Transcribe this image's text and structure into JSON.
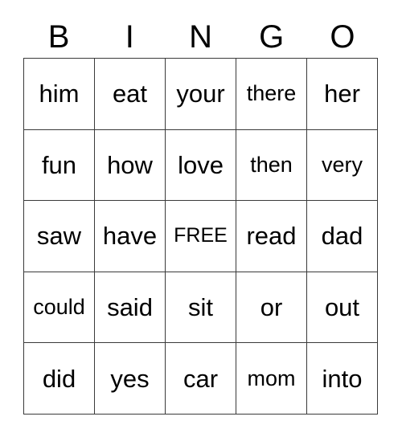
{
  "card": {
    "title_letters": [
      "B",
      "I",
      "N",
      "G",
      "O"
    ],
    "grid": [
      [
        "him",
        "eat",
        "your",
        "there",
        "her"
      ],
      [
        "fun",
        "how",
        "love",
        "then",
        "very"
      ],
      [
        "saw",
        "have",
        "FREE",
        "read",
        "dad"
      ],
      [
        "could",
        "said",
        "sit",
        "or",
        "out"
      ],
      [
        "did",
        "yes",
        "car",
        "mom",
        "into"
      ]
    ],
    "free_space": {
      "row": 2,
      "col": 2,
      "label": "FREE"
    },
    "colors": {
      "background": "#ffffff",
      "text": "#000000",
      "border": "#3a3a3a"
    }
  }
}
